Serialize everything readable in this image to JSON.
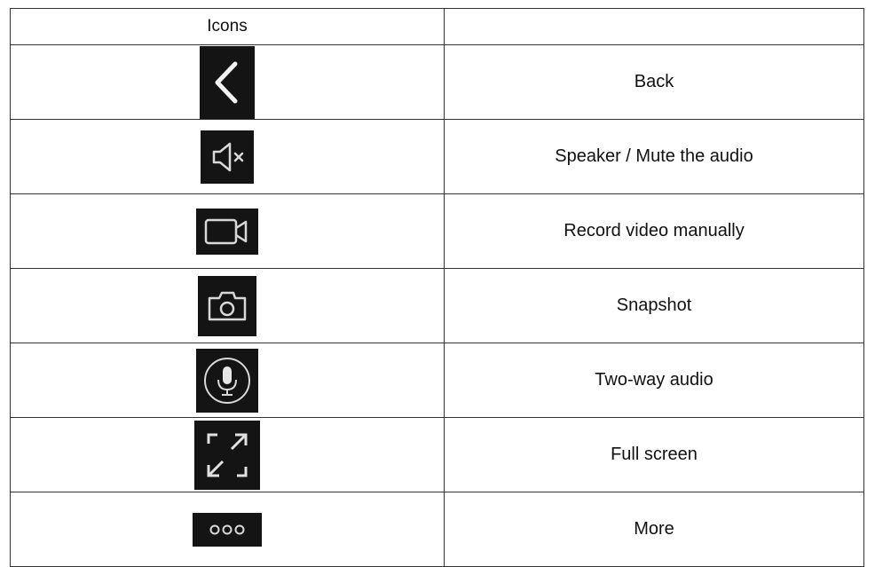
{
  "table": {
    "header": {
      "col1": "Icons",
      "col2": ""
    },
    "rows": [
      {
        "icon": "chevron-left-icon",
        "label": "Back"
      },
      {
        "icon": "speaker-mute-icon",
        "label": "Speaker / Mute the audio"
      },
      {
        "icon": "video-camera-icon",
        "label": "Record video manually"
      },
      {
        "icon": "camera-icon",
        "label": "Snapshot"
      },
      {
        "icon": "microphone-icon",
        "label": "Two-way audio"
      },
      {
        "icon": "fullscreen-icon",
        "label": "Full screen"
      },
      {
        "icon": "more-dots-icon",
        "label": "More"
      }
    ]
  },
  "colors": {
    "icon_background": "#141414",
    "icon_stroke": "#d8d8d8",
    "border": "#333333"
  }
}
